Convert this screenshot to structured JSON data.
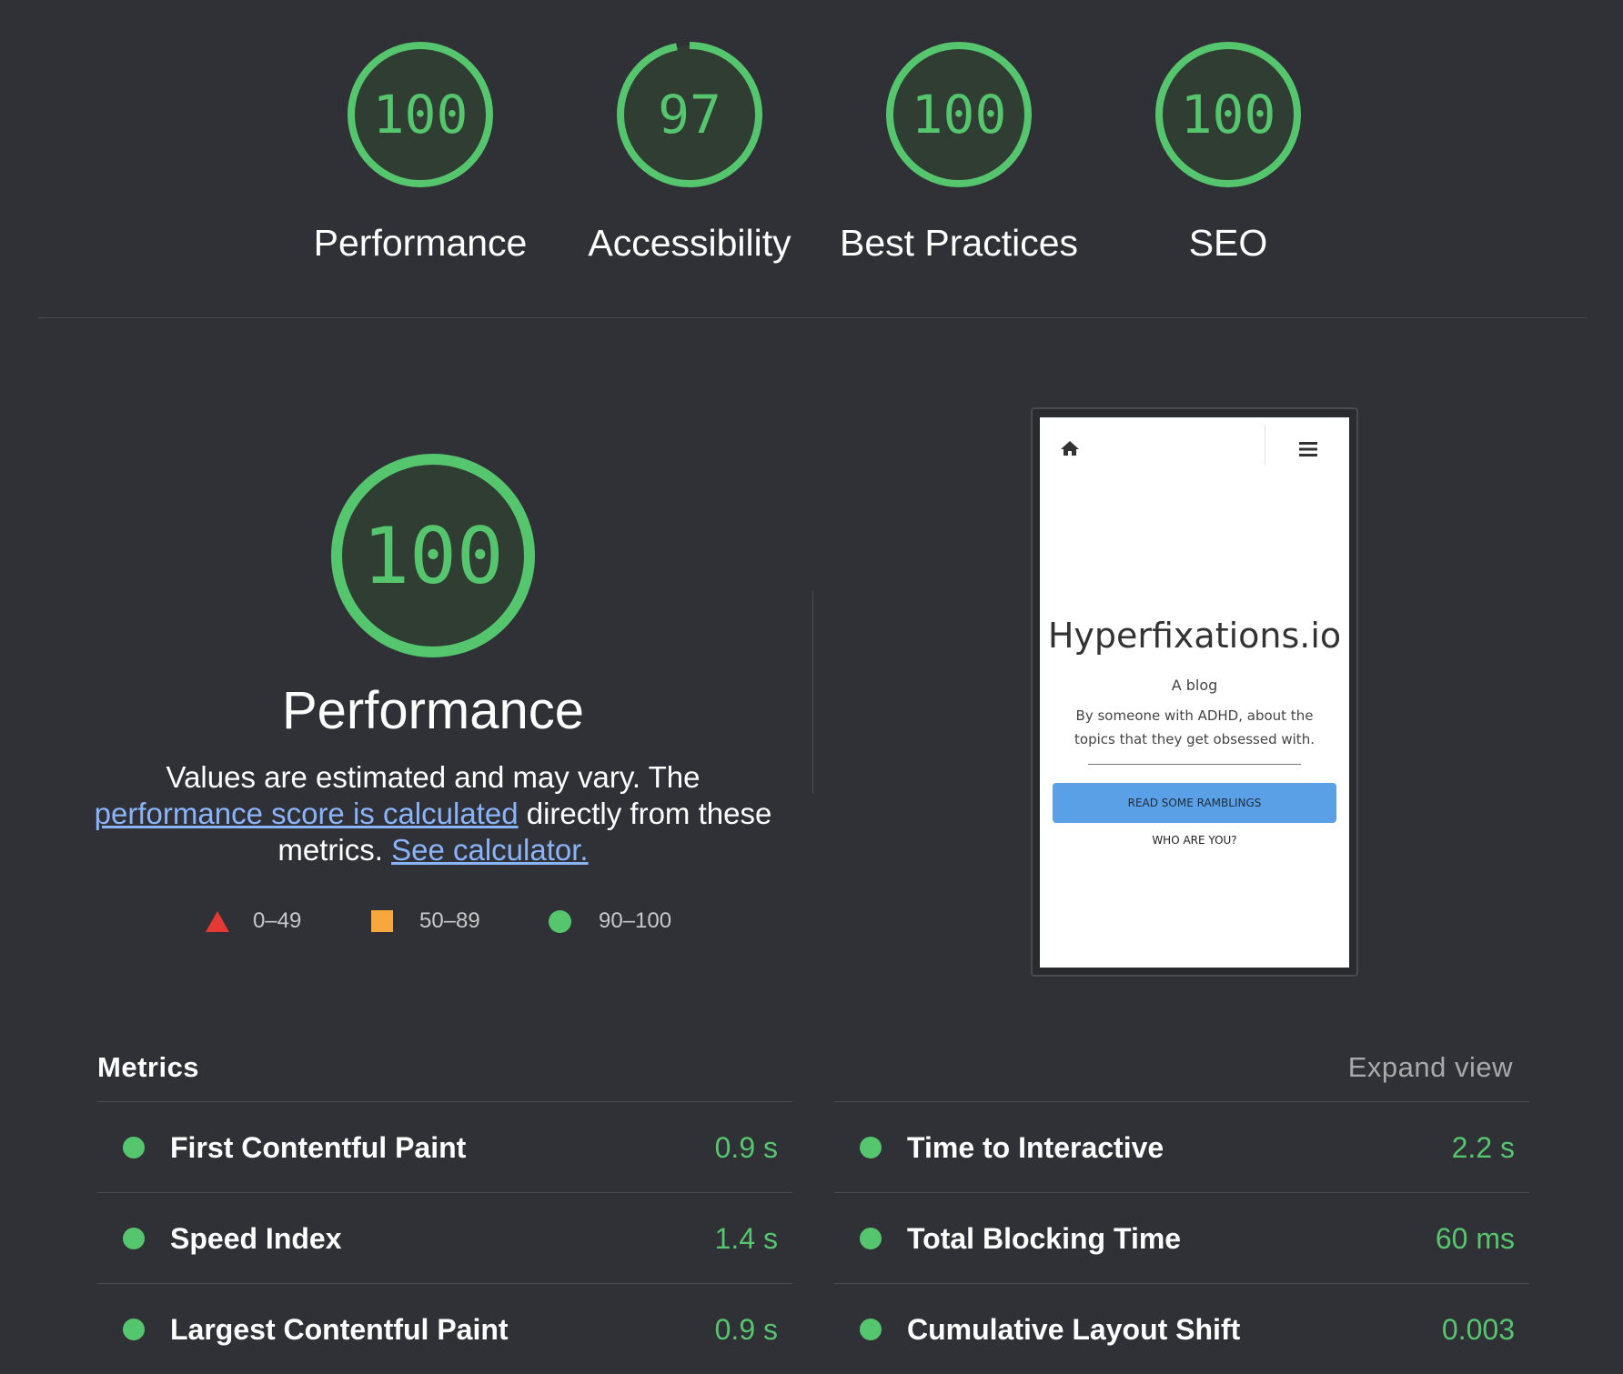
{
  "colors": {
    "pass": "#55c66e",
    "average": "#f7a73b",
    "fail": "#e53935",
    "link": "#8ab4f8",
    "background": "#303136"
  },
  "gauges": [
    {
      "score": "100",
      "value": 100,
      "label": "Performance"
    },
    {
      "score": "97",
      "value": 97,
      "label": "Accessibility"
    },
    {
      "score": "100",
      "value": 100,
      "label": "Best Practices"
    },
    {
      "score": "100",
      "value": 100,
      "label": "SEO"
    }
  ],
  "performance": {
    "score": "100",
    "value": 100,
    "title": "Performance",
    "desc_prefix": "Values are estimated and may vary. The ",
    "desc_link": "performance score is calculated",
    "desc_middle": " directly from these metrics. ",
    "calculator_link": "See calculator."
  },
  "legend": {
    "fail": "0–49",
    "average": "50–89",
    "pass": "90–100"
  },
  "screenshot": {
    "site_title": "Hyperfixations.io",
    "tagline": "A blog",
    "blurb": "By someone with ADHD, about the topics that they get obsessed with.",
    "cta": "READ SOME RAMBLINGS",
    "secondary": "WHO ARE YOU?",
    "home_icon": "home-icon",
    "menu_icon": "hamburger-menu-icon"
  },
  "metrics": {
    "title": "Metrics",
    "expand": "Expand view",
    "left": [
      {
        "name": "First Contentful Paint",
        "value": "0.9 s"
      },
      {
        "name": "Speed Index",
        "value": "1.4 s"
      },
      {
        "name": "Largest Contentful Paint",
        "value": "0.9 s"
      }
    ],
    "right": [
      {
        "name": "Time to Interactive",
        "value": "2.2 s"
      },
      {
        "name": "Total Blocking Time",
        "value": "60 ms"
      },
      {
        "name": "Cumulative Layout Shift",
        "value": "0.003"
      }
    ]
  }
}
